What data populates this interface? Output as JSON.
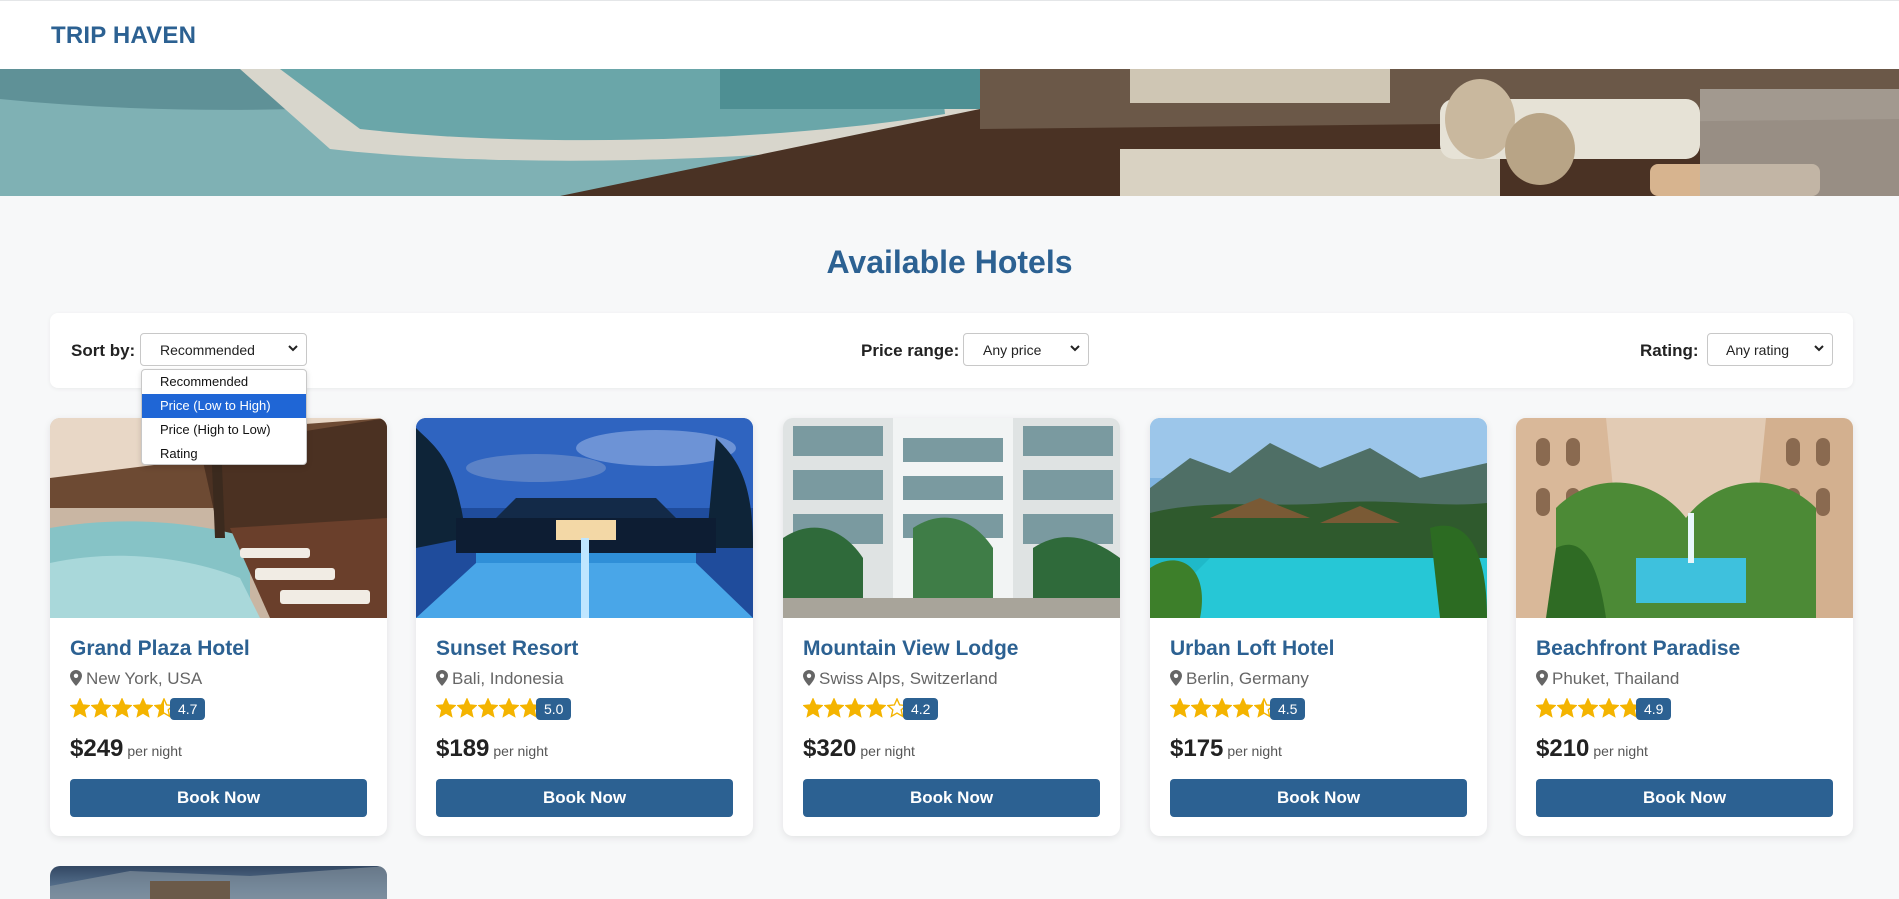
{
  "brand": {
    "name": "TRIP HAVEN"
  },
  "page": {
    "title": "Available Hotels"
  },
  "filters": {
    "sort": {
      "label": "Sort by:",
      "value": "Recommended"
    },
    "price": {
      "label": "Price range:",
      "value": "Any price"
    },
    "rating": {
      "label": "Rating:",
      "value": "Any rating"
    }
  },
  "sort_dropdown": {
    "options": [
      "Recommended",
      "Price (Low to High)",
      "Price (High to Low)",
      "Rating"
    ],
    "highlighted": "Price (Low to High)"
  },
  "per_night_label": "per night",
  "book_label": "Book Now",
  "hotels": [
    {
      "name": "Grand Plaza Hotel",
      "location": "New York, USA",
      "rating": "4.7",
      "price": "$249"
    },
    {
      "name": "Sunset Resort",
      "location": "Bali, Indonesia",
      "rating": "5.0",
      "price": "$189"
    },
    {
      "name": "Mountain View Lodge",
      "location": "Swiss Alps, Switzerland",
      "rating": "4.2",
      "price": "$320"
    },
    {
      "name": "Urban Loft Hotel",
      "location": "Berlin, Germany",
      "rating": "4.5",
      "price": "$175"
    },
    {
      "name": "Beachfront Paradise",
      "location": "Phuket, Thailand",
      "rating": "4.9",
      "price": "$210"
    }
  ],
  "colors": {
    "brand": "#2c6192",
    "star": "#f4b400",
    "highlight": "#1f66d6"
  },
  "icons": {
    "location": "map-pin-icon",
    "star": "star-icon",
    "dropdown": "chevron-down-icon"
  }
}
